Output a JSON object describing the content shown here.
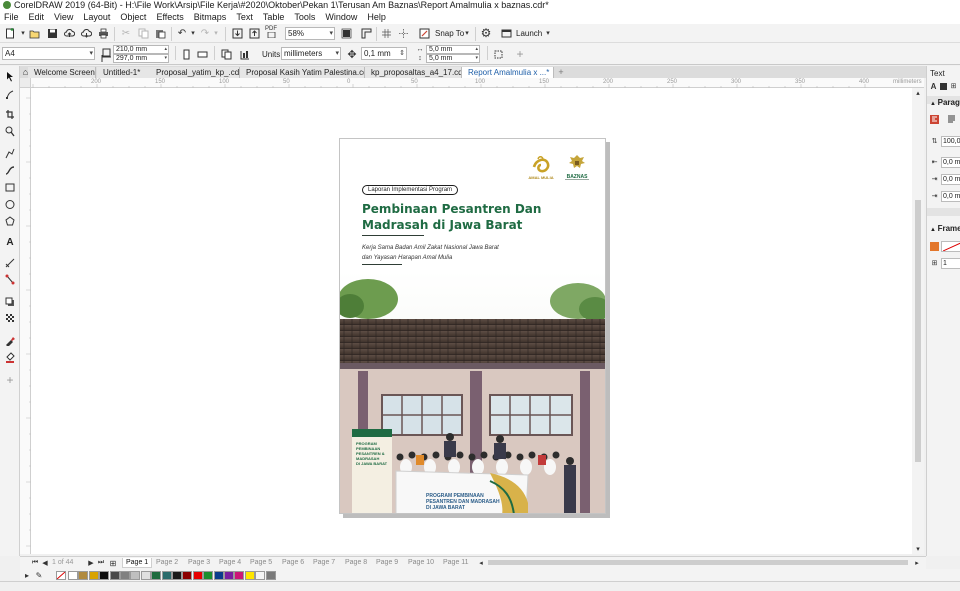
{
  "window": {
    "title": "CorelDRAW 2019 (64-Bit) - H:\\File Work\\Arsip\\File Kerja\\#2020\\Oktober\\Pekan 1\\Terusan Am Baznas\\Report Amalmulia x baznas.cdr*"
  },
  "menu": [
    "File",
    "Edit",
    "View",
    "Layout",
    "Object",
    "Effects",
    "Bitmaps",
    "Text",
    "Table",
    "Tools",
    "Window",
    "Help"
  ],
  "toolbar": {
    "zoom": "58%",
    "snap_to": "Snap To",
    "launch": "Launch",
    "pdf_label": "PDF"
  },
  "propertybar": {
    "page_size": "A4",
    "width": "210,0 mm",
    "height": "297,0 mm",
    "units_label": "Units:",
    "units_value": "millimeters",
    "nudge": "0,1 mm",
    "dup_x": "5,0 mm",
    "dup_y": "5,0 mm"
  },
  "doc_tabs": [
    {
      "label": "Welcome Screen",
      "active": false
    },
    {
      "label": "Untitled-1*",
      "active": false
    },
    {
      "label": "Proposal_yatim_kp_.cdr",
      "active": false
    },
    {
      "label": "Proposal Kasih Yatim Palestina.cdr*",
      "active": false
    },
    {
      "label": "kp_proposaltas_a4_17.cdr*",
      "active": false
    },
    {
      "label": "Report Amalmulia x ...*",
      "active": true
    }
  ],
  "ruler": {
    "unit": "millimeters",
    "h_ticks": [
      "200",
      "150",
      "100",
      "50",
      "0",
      "50",
      "100",
      "150",
      "200",
      "250",
      "300",
      "350",
      "400",
      "450"
    ]
  },
  "document": {
    "pill_label": "Laporan Implementasi Program",
    "title_line1": "Pembinaan Pesantren Dan",
    "title_line2": "Madrasah di Jawa Barat",
    "subtitle_line1": "Kerja Sama Badan Amil Zakat Nasional Jawa Barat",
    "subtitle_line2": "dan Yayasan Harapan Amal Mulia",
    "logo_left": "AMAL MULIA",
    "logo_right": "BAZNAS",
    "banner_text_1": "PROGRAM PEMBINAAN",
    "banner_text_2": "PESANTREN DAN MADRASAH",
    "banner_text_3": "DI JAWA BARAT",
    "standee_text_1": "PROGRAM",
    "standee_text_2": "PEMBINAAN",
    "standee_text_3": "PESANTREN &",
    "standee_text_4": "MADRASAH",
    "standee_text_5": "DI JAWA BARAT"
  },
  "pages": {
    "count_label": "1 of 44",
    "tabs": [
      "Page 1",
      "Page 2",
      "Page 3",
      "Page 4",
      "Page 5",
      "Page 6",
      "Page 7",
      "Page 8",
      "Page 9",
      "Page 10",
      "Page 11"
    ]
  },
  "palette": [
    "#ffffff",
    "#b08a3e",
    "#d8a300",
    "#0e0e0e",
    "#4a4a4a",
    "#808080",
    "#bfbfbf",
    "#e0e0e0",
    "#1e6b3e",
    "#2a6b6b",
    "#1a1a1a",
    "#8b0000",
    "#e60000",
    "#1a8f2e",
    "#0b3c8c",
    "#7a1fa0",
    "#cc1677",
    "#ffe600",
    "#f5f5f5",
    "#7a7a7a"
  ],
  "docker": {
    "title": "Text",
    "section1": "Parag",
    "val1": "100,0",
    "val2": "0,0 m",
    "val3": "0,0 m",
    "val4": "0,0 m",
    "section2": "Frame",
    "val5": "1"
  }
}
